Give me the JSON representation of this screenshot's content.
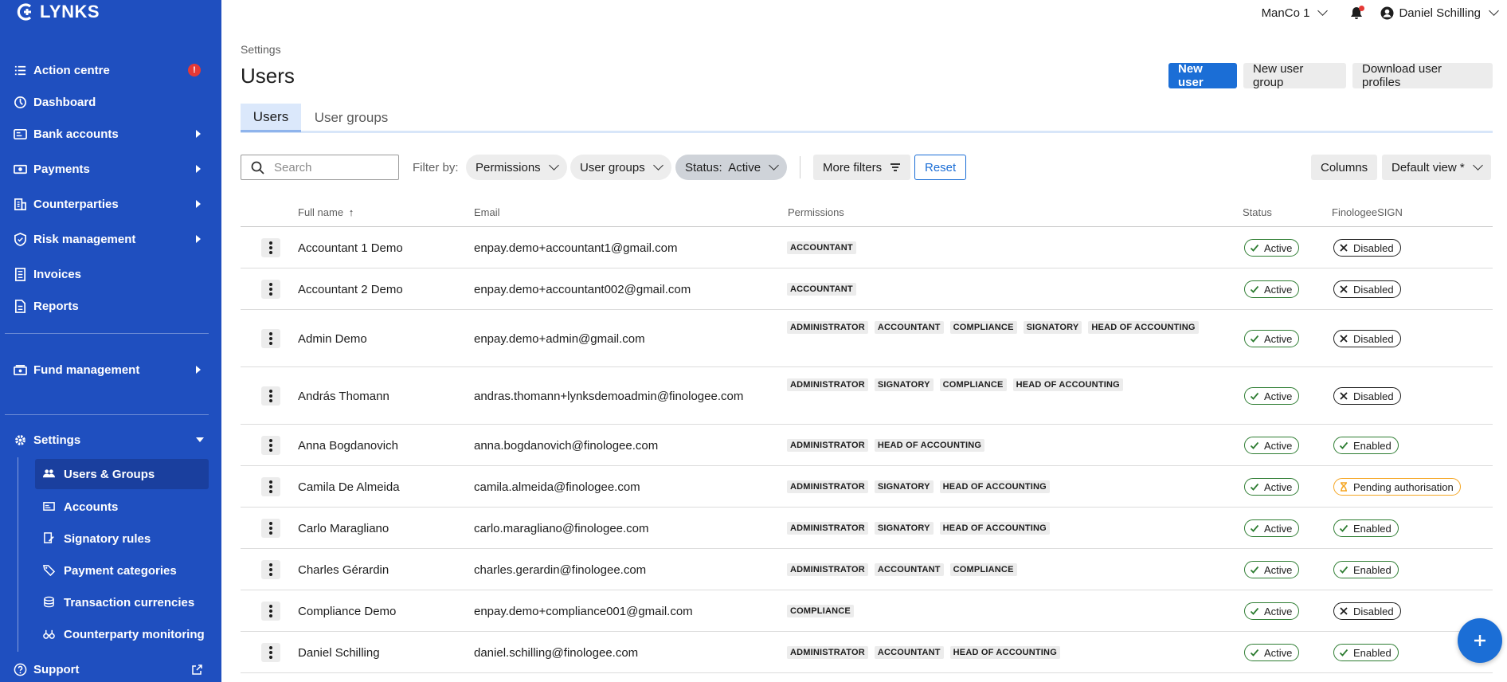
{
  "app": {
    "logo_text": "LYNKS"
  },
  "sidebar": {
    "items": [
      {
        "label": "Action centre",
        "icon": "list-check-icon",
        "alert": "!"
      },
      {
        "label": "Dashboard",
        "icon": "dashboard-icon"
      },
      {
        "label": "Bank accounts",
        "icon": "bank-card-icon"
      },
      {
        "label": "Payments",
        "icon": "cash-icon"
      },
      {
        "label": "Counterparties",
        "icon": "building-icon"
      },
      {
        "label": "Risk management",
        "icon": "shield-icon"
      },
      {
        "label": "Invoices",
        "icon": "invoice-icon"
      },
      {
        "label": "Reports",
        "icon": "report-icon"
      },
      {
        "label": "Fund management",
        "icon": "fund-icon"
      },
      {
        "label": "Settings",
        "icon": "gear-icon"
      },
      {
        "label": "Support",
        "icon": "help-icon"
      }
    ],
    "settings_sub": [
      {
        "label": "Users & Groups",
        "icon": "users-icon"
      },
      {
        "label": "Accounts",
        "icon": "accounts-icon"
      },
      {
        "label": "Signatory rules",
        "icon": "signature-icon"
      },
      {
        "label": "Payment categories",
        "icon": "tag-icon"
      },
      {
        "label": "Transaction currencies",
        "icon": "coins-icon"
      },
      {
        "label": "Counterparty monitoring",
        "icon": "binoculars-icon"
      }
    ]
  },
  "topbar": {
    "entity": "ManCo 1",
    "user": "Daniel Schilling"
  },
  "header": {
    "breadcrumb": "Settings",
    "title": "Users",
    "new_user": "New user",
    "new_group": "New user group",
    "download": "Download user profiles"
  },
  "tabs": [
    "Users",
    "User groups"
  ],
  "filters": {
    "search_placeholder": "Search",
    "filter_by": "Filter by:",
    "permissions": "Permissions",
    "user_groups": "User groups",
    "status": "Status:  Active",
    "more_filters": "More filters",
    "reset": "Reset",
    "columns": "Columns",
    "view": "Default view *"
  },
  "table": {
    "columns": [
      "Full name",
      "Email",
      "Permissions",
      "Status",
      "FinologeeSIGN"
    ],
    "rows": [
      {
        "name": "Accountant 1 Demo",
        "email": "enpay.demo+accountant1@gmail.com",
        "permissions": [
          "ACCOUNTANT"
        ],
        "status": "Active",
        "sign": "Disabled"
      },
      {
        "name": "Accountant 2 Demo",
        "email": "enpay.demo+accountant002@gmail.com",
        "permissions": [
          "ACCOUNTANT"
        ],
        "status": "Active",
        "sign": "Disabled"
      },
      {
        "name": "Admin Demo",
        "email": "enpay.demo+admin@gmail.com",
        "permissions": [
          "ADMINISTRATOR",
          "ACCOUNTANT",
          "COMPLIANCE",
          "SIGNATORY",
          "HEAD OF ACCOUNTING"
        ],
        "status": "Active",
        "sign": "Disabled"
      },
      {
        "name": "András Thomann",
        "email": "andras.thomann+lynksdemoadmin@finologee.com",
        "permissions": [
          "ADMINISTRATOR",
          "SIGNATORY",
          "COMPLIANCE",
          "HEAD OF ACCOUNTING"
        ],
        "status": "Active",
        "sign": "Disabled"
      },
      {
        "name": "Anna Bogdanovich",
        "email": "anna.bogdanovich@finologee.com",
        "permissions": [
          "ADMINISTRATOR",
          "HEAD OF ACCOUNTING"
        ],
        "status": "Active",
        "sign": "Enabled"
      },
      {
        "name": "Camila De Almeida",
        "email": "camila.almeida@finologee.com",
        "permissions": [
          "ADMINISTRATOR",
          "SIGNATORY",
          "HEAD OF ACCOUNTING"
        ],
        "status": "Active",
        "sign": "Pending authorisation"
      },
      {
        "name": "Carlo Maragliano",
        "email": "carlo.maragliano@finologee.com",
        "permissions": [
          "ADMINISTRATOR",
          "SIGNATORY",
          "HEAD OF ACCOUNTING"
        ],
        "status": "Active",
        "sign": "Enabled"
      },
      {
        "name": "Charles Gérardin",
        "email": "charles.gerardin@finologee.com",
        "permissions": [
          "ADMINISTRATOR",
          "ACCOUNTANT",
          "COMPLIANCE"
        ],
        "status": "Active",
        "sign": "Enabled"
      },
      {
        "name": "Compliance Demo",
        "email": "enpay.demo+compliance001@gmail.com",
        "permissions": [
          "COMPLIANCE"
        ],
        "status": "Active",
        "sign": "Disabled"
      },
      {
        "name": "Daniel Schilling",
        "email": "daniel.schilling@finologee.com",
        "permissions": [
          "ADMINISTRATOR",
          "ACCOUNTANT",
          "HEAD OF ACCOUNTING"
        ],
        "status": "Active",
        "sign": "Enabled"
      }
    ]
  },
  "colors": {
    "sidebar": "#1f4fbf",
    "primary": "#1b6ed6",
    "success": "#2e7d32",
    "warning": "#f5a623",
    "alert": "#e53935"
  }
}
